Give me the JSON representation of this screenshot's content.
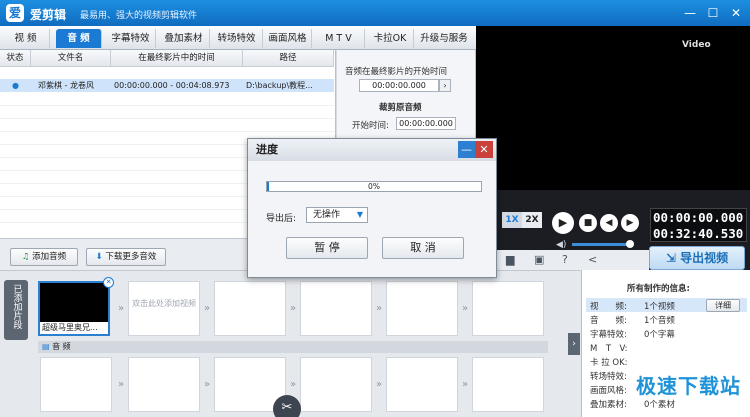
{
  "titlebar": {
    "app_name": "爱剪辑",
    "slogan": "最易用、强大的视频剪辑软件",
    "min": "—",
    "max": "☐",
    "close": "✕"
  },
  "tabs": [
    "视 频",
    "音 频",
    "字幕特效",
    "叠加素材",
    "转场特效",
    "画面风格",
    "M T V",
    "卡拉OK",
    "升级与服务"
  ],
  "active_tab": "音 频",
  "table": {
    "headers": [
      "状态",
      "文件名",
      "在最终影片中的时间",
      "路径"
    ],
    "rows": [
      {
        "status": "●",
        "name": "邓紫棋 - 龙卷风",
        "time": "00:00:00.000 - 00:04:08.973",
        "path": "D:\\backup\\教程..."
      }
    ]
  },
  "audio_info": {
    "start_title": "音频在最终影片的开始时间",
    "start_value": "00:00:00.000",
    "clip_title": "裁剪原音频",
    "start_label": "开始时间:",
    "start_time": "00:00:00.000"
  },
  "music_buttons": {
    "add": "添加音频",
    "download": "下载更多音效"
  },
  "dialog": {
    "title": "进度",
    "progress_text": "0%",
    "progress": 0.01,
    "after_label": "导出后:",
    "after_value": "无操作",
    "pause": "暂 停",
    "cancel": "取 消"
  },
  "player": {
    "current_time": "00:00:00.000",
    "total_time": "00:32:40.530",
    "speed1": "1X",
    "speed2": "2X",
    "video_label": "Video"
  },
  "export_button": "导出视频",
  "timeline": {
    "side_tab": "已添加片段",
    "clip_name": "超级马里奥兄...",
    "placeholder": "双击此处添加视频",
    "audio_track": "音 频"
  },
  "info_panel": {
    "title": "所有制作的信息:",
    "detail_button": "详细",
    "rows": [
      {
        "label": "视　　频:",
        "value": "1个视频"
      },
      {
        "label": "音　　频:",
        "value": "1个音频"
      },
      {
        "label": "字幕特效:",
        "value": "0个字幕"
      },
      {
        "label": "M　T　V:",
        "value": ""
      },
      {
        "label": "卡 拉 OK:",
        "value": ""
      },
      {
        "label": "转场特效:",
        "value": ""
      },
      {
        "label": "画面风格:",
        "value": ""
      },
      {
        "label": "叠加素材:",
        "value": "0个素材"
      }
    ]
  },
  "watermark": "极速下载站",
  "colors": {
    "accent": "#1b7bd4",
    "titlebar": "#1577cf",
    "close": "#c9413a"
  }
}
